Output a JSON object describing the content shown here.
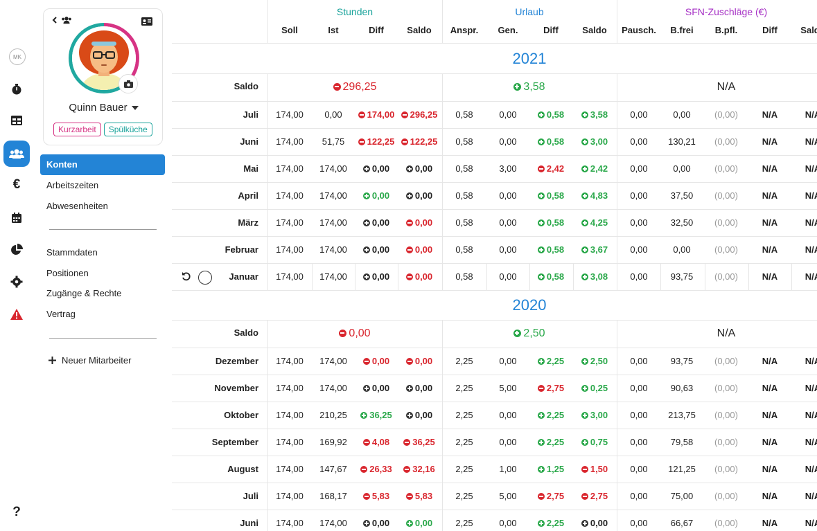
{
  "rail": {
    "initials": "MK",
    "items": [
      {
        "icon": "stopwatch-icon",
        "active": false
      },
      {
        "icon": "table-icon",
        "active": false
      },
      {
        "icon": "users-icon",
        "active": true
      },
      {
        "icon": "euro-icon",
        "active": false
      },
      {
        "icon": "calendar-icon",
        "active": false
      },
      {
        "icon": "pie-chart-icon",
        "active": false
      },
      {
        "icon": "gear-icon",
        "active": false
      },
      {
        "icon": "warning-icon",
        "active": false
      },
      {
        "icon": "help-icon",
        "active": false
      }
    ]
  },
  "profile": {
    "name": "Quinn Bauer",
    "tags": [
      "Kurzarbeit",
      "Spülküche"
    ]
  },
  "nav": {
    "group1": [
      "Konten",
      "Arbeitszeiten",
      "Abwesenheiten"
    ],
    "group2": [
      "Stammdaten",
      "Positionen",
      "Zugänge & Rechte",
      "Vertrag"
    ],
    "new_employee": "Neuer Mitarbeiter"
  },
  "table": {
    "groups": {
      "stunden": "Stunden",
      "urlaub": "Urlaub",
      "sfn": "SFN-Zuschläge (€)"
    },
    "columns": [
      "Soll",
      "Ist",
      "Diff",
      "Saldo",
      "Anspr.",
      "Gen.",
      "Diff",
      "Saldo",
      "Pausch.",
      "B.frei",
      "B.pfl.",
      "Diff",
      "Saldo"
    ],
    "saldo_label": "Saldo",
    "years": [
      {
        "year": "2021",
        "saldo": {
          "stunden": "296,25",
          "stunden_sign": "red",
          "urlaub": "3,58",
          "urlaub_sign": "green",
          "sfn": "N/A"
        },
        "rows": [
          {
            "month": "Juli",
            "v": [
              "174,00",
              "0,00",
              "174,00",
              "296,25",
              "0,58",
              "0,00",
              "0,58",
              "3,58",
              "0,00",
              "0,00",
              "(0,00)",
              "N/A",
              "N/A"
            ],
            "s": [
              "",
              "",
              "red",
              "red",
              "",
              "",
              "green",
              "green",
              "",
              "",
              "",
              "",
              ""
            ]
          },
          {
            "month": "Juni",
            "v": [
              "174,00",
              "51,75",
              "122,25",
              "122,25",
              "0,58",
              "0,00",
              "0,58",
              "3,00",
              "0,00",
              "130,21",
              "(0,00)",
              "N/A",
              "N/A"
            ],
            "s": [
              "",
              "",
              "red",
              "red",
              "",
              "",
              "green",
              "green",
              "",
              "",
              "",
              "",
              ""
            ]
          },
          {
            "month": "Mai",
            "v": [
              "174,00",
              "174,00",
              "0,00",
              "0,00",
              "0,58",
              "3,00",
              "2,42",
              "2,42",
              "0,00",
              "0,00",
              "(0,00)",
              "N/A",
              "N/A"
            ],
            "s": [
              "",
              "",
              "neutral",
              "neutral",
              "",
              "",
              "red",
              "green",
              "",
              "",
              "",
              "",
              ""
            ]
          },
          {
            "month": "April",
            "v": [
              "174,00",
              "174,00",
              "0,00",
              "0,00",
              "0,58",
              "0,00",
              "0,58",
              "4,83",
              "0,00",
              "37,50",
              "(0,00)",
              "N/A",
              "N/A"
            ],
            "s": [
              "",
              "",
              "green",
              "neutral",
              "",
              "",
              "green",
              "green",
              "",
              "",
              "",
              "",
              ""
            ]
          },
          {
            "month": "März",
            "v": [
              "174,00",
              "174,00",
              "0,00",
              "0,00",
              "0,58",
              "0,00",
              "0,58",
              "4,25",
              "0,00",
              "32,50",
              "(0,00)",
              "N/A",
              "N/A"
            ],
            "s": [
              "",
              "",
              "neutral",
              "red",
              "",
              "",
              "green",
              "green",
              "",
              "",
              "",
              "",
              ""
            ]
          },
          {
            "month": "Februar",
            "v": [
              "174,00",
              "174,00",
              "0,00",
              "0,00",
              "0,58",
              "0,00",
              "0,58",
              "3,67",
              "0,00",
              "0,00",
              "(0,00)",
              "N/A",
              "N/A"
            ],
            "s": [
              "",
              "",
              "neutral",
              "red",
              "",
              "",
              "green",
              "green",
              "",
              "",
              "",
              "",
              ""
            ]
          },
          {
            "month": "Januar",
            "v": [
              "174,00",
              "174,00",
              "0,00",
              "0,00",
              "0,58",
              "0,00",
              "0,58",
              "3,08",
              "0,00",
              "93,75",
              "(0,00)",
              "N/A",
              "N/A"
            ],
            "s": [
              "",
              "",
              "neutral",
              "red",
              "",
              "",
              "green",
              "green",
              "",
              "",
              "",
              "",
              ""
            ]
          }
        ]
      },
      {
        "year": "2020",
        "saldo": {
          "stunden": "0,00",
          "stunden_sign": "red",
          "urlaub": "2,50",
          "urlaub_sign": "green",
          "sfn": "N/A"
        },
        "rows": [
          {
            "month": "Dezember",
            "v": [
              "174,00",
              "174,00",
              "0,00",
              "0,00",
              "2,25",
              "0,00",
              "2,25",
              "2,50",
              "0,00",
              "93,75",
              "(0,00)",
              "N/A",
              "N/A"
            ],
            "s": [
              "",
              "",
              "red",
              "red",
              "",
              "",
              "green",
              "green",
              "",
              "",
              "",
              "",
              ""
            ]
          },
          {
            "month": "November",
            "v": [
              "174,00",
              "174,00",
              "0,00",
              "0,00",
              "2,25",
              "5,00",
              "2,75",
              "0,25",
              "0,00",
              "90,63",
              "(0,00)",
              "N/A",
              "N/A"
            ],
            "s": [
              "",
              "",
              "neutral",
              "neutral",
              "",
              "",
              "red",
              "green",
              "",
              "",
              "",
              "",
              ""
            ]
          },
          {
            "month": "Oktober",
            "v": [
              "174,00",
              "210,25",
              "36,25",
              "0,00",
              "2,25",
              "0,00",
              "2,25",
              "3,00",
              "0,00",
              "213,75",
              "(0,00)",
              "N/A",
              "N/A"
            ],
            "s": [
              "",
              "",
              "green",
              "neutral",
              "",
              "",
              "green",
              "green",
              "",
              "",
              "",
              "",
              ""
            ]
          },
          {
            "month": "September",
            "v": [
              "174,00",
              "169,92",
              "4,08",
              "36,25",
              "2,25",
              "0,00",
              "2,25",
              "0,75",
              "0,00",
              "79,58",
              "(0,00)",
              "N/A",
              "N/A"
            ],
            "s": [
              "",
              "",
              "red",
              "red",
              "",
              "",
              "green",
              "green",
              "",
              "",
              "",
              "",
              ""
            ]
          },
          {
            "month": "August",
            "v": [
              "174,00",
              "147,67",
              "26,33",
              "32,16",
              "2,25",
              "1,00",
              "1,25",
              "1,50",
              "0,00",
              "121,25",
              "(0,00)",
              "N/A",
              "N/A"
            ],
            "s": [
              "",
              "",
              "red",
              "red",
              "",
              "",
              "green",
              "red",
              "",
              "",
              "",
              "",
              ""
            ]
          },
          {
            "month": "Juli",
            "v": [
              "174,00",
              "168,17",
              "5,83",
              "5,83",
              "2,25",
              "5,00",
              "2,75",
              "2,75",
              "0,00",
              "75,00",
              "(0,00)",
              "N/A",
              "N/A"
            ],
            "s": [
              "",
              "",
              "red",
              "red",
              "",
              "",
              "red",
              "red",
              "",
              "",
              "",
              "",
              ""
            ]
          },
          {
            "month": "Juni",
            "v": [
              "174,00",
              "174,00",
              "0,00",
              "0,00",
              "2,25",
              "0,00",
              "2,25",
              "0,00",
              "0,00",
              "66,67",
              "(0,00)",
              "N/A",
              "N/A"
            ],
            "s": [
              "",
              "",
              "neutral",
              "green",
              "",
              "",
              "green",
              "neutral",
              "",
              "",
              "",
              "",
              ""
            ]
          }
        ]
      }
    ]
  },
  "colors": {
    "accent": "#2384d6",
    "stunden": "#1aa39b",
    "urlaub": "#2384d6",
    "sfn": "#a52fc4",
    "red": "#d9262e",
    "green": "#2aa84a"
  }
}
